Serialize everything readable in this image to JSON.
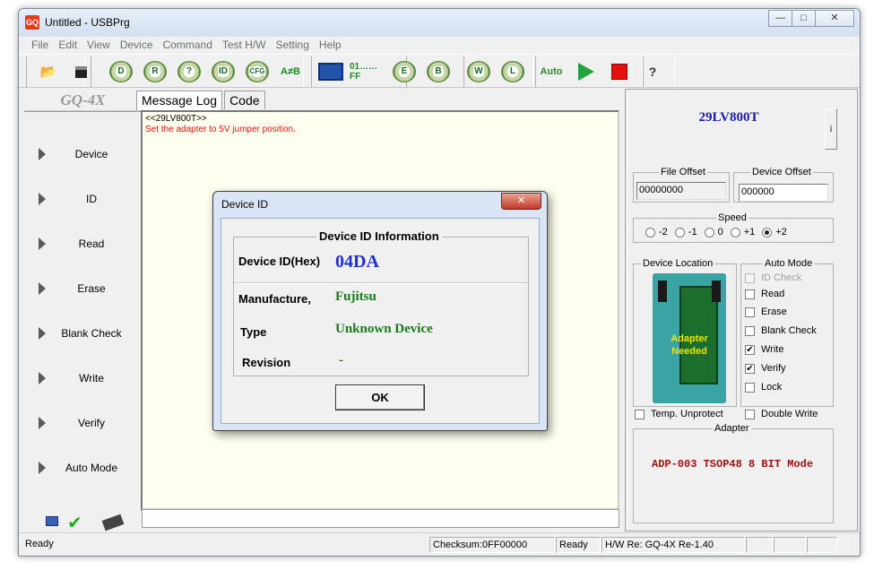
{
  "window": {
    "title": "Untitled - USBPrg",
    "app_icon": "GQ"
  },
  "menu": [
    "File",
    "Edit",
    "View",
    "Device",
    "Command",
    "Test H/W",
    "Setting",
    "Help"
  ],
  "toolbar": {
    "read_gear": "R",
    "device_gear": "D",
    "verify_gear": "?",
    "id_gear": "ID",
    "cfg_gear": "CFG",
    "compare_label": "A≠B",
    "hex_label": "01……FF",
    "erase_gear": "E",
    "blank_gear": "B",
    "write_gear": "W",
    "lock_gear": "L",
    "auto_label": "Auto",
    "help_label": "?"
  },
  "left_panel": {
    "logo": "GQ-4X",
    "buttons": [
      "Device",
      "ID",
      "Read",
      "Erase",
      "Blank Check",
      "Write",
      "Verify",
      "Auto Mode"
    ]
  },
  "tabs": [
    "Message Log",
    "Code"
  ],
  "log": {
    "lines": [
      "<<29LV800T>>",
      "Set the adapter to 5V jumper position."
    ]
  },
  "right_panel": {
    "device_name": "29LV800T",
    "info_button": "i",
    "file_offset": {
      "label": "File Offset",
      "value": "00000000"
    },
    "device_offset": {
      "label": "Device Offset",
      "value": "000000"
    },
    "speed": {
      "label": "Speed",
      "options": [
        "-2",
        "-1",
        "0",
        "+1",
        "+2"
      ],
      "selected": "+2"
    },
    "device_location": {
      "label": "Device Location",
      "text_line1": "Adapter",
      "text_line2": "Needed"
    },
    "auto_mode": {
      "label": "Auto Mode",
      "items": [
        {
          "label": "ID Check",
          "checked": false,
          "enabled": false
        },
        {
          "label": "Read",
          "checked": false,
          "enabled": true
        },
        {
          "label": "Erase",
          "checked": false,
          "enabled": true
        },
        {
          "label": "Blank Check",
          "checked": false,
          "enabled": true
        },
        {
          "label": "Write",
          "checked": true,
          "enabled": true
        },
        {
          "label": "Verify",
          "checked": true,
          "enabled": true
        },
        {
          "label": "Lock",
          "checked": false,
          "enabled": true
        }
      ]
    },
    "temp_unprotect": {
      "label": "Temp. Unprotect",
      "checked": false
    },
    "double_write": {
      "label": "Double Write",
      "checked": false
    },
    "adapter": {
      "label": "Adapter",
      "mode": "ADP-003 TSOP48 8 BIT Mode"
    }
  },
  "statusbar": {
    "status": "Ready",
    "checksum": "Checksum:0FF00000",
    "state": "Ready",
    "hw": "H/W Re: GQ-4X Re-1.40"
  },
  "dialog": {
    "title": "Device ID",
    "close": "✕",
    "group_title": "Device ID Information",
    "device_id_label": "Device ID(Hex)",
    "device_id_value": "04DA",
    "manufacture_label": "Manufacture,",
    "manufacture_value": "Fujitsu",
    "type_label": "Type",
    "type_value": "Unknown Device",
    "revision_label": "Revision",
    "revision_value": "-",
    "ok_label": "OK",
    "colors": {
      "id_value": "#1f2fd0",
      "green_value": "#1a7a1a"
    }
  },
  "colors": {
    "log_bg": "#fffff0",
    "log_warning": "#e01010",
    "device_name": "#1a1aa0",
    "adapter_mode": "#a01010"
  }
}
